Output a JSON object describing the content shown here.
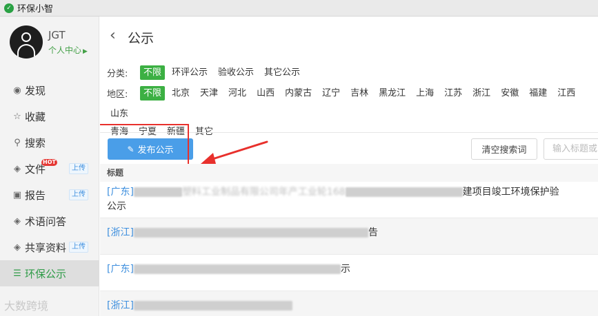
{
  "app": {
    "title": "环保小智"
  },
  "user": {
    "name": "JGT",
    "center_label": "个人中心"
  },
  "nav": {
    "items": [
      {
        "label": "发现",
        "icon": "eye-icon",
        "glyph": "◉"
      },
      {
        "label": "收藏",
        "icon": "star-icon",
        "glyph": "☆"
      },
      {
        "label": "搜索",
        "icon": "search-icon",
        "glyph": "⚲"
      },
      {
        "label": "文件",
        "icon": "layers-icon",
        "glyph": "◈",
        "badge": "HOT",
        "tag": "上传"
      },
      {
        "label": "报告",
        "icon": "report-icon",
        "glyph": "▣",
        "tag": "上传"
      },
      {
        "label": "术语问答",
        "icon": "layers-icon",
        "glyph": "◈"
      },
      {
        "label": "共享资料",
        "icon": "layers-icon",
        "glyph": "◈",
        "tag": "上传"
      },
      {
        "label": "环保公示",
        "icon": "notice-icon",
        "glyph": "☰",
        "active": true
      }
    ]
  },
  "watermark": "大数跨境",
  "page": {
    "back_glyph": "‹",
    "title": "公示"
  },
  "filters": {
    "category_label": "分类:",
    "categories": [
      "不限",
      "环评公示",
      "验收公示",
      "其它公示"
    ],
    "region_label": "地区:",
    "regions": [
      "不限",
      "北京",
      "天津",
      "河北",
      "山西",
      "内蒙古",
      "辽宁",
      "吉林",
      "黑龙江",
      "上海",
      "江苏",
      "浙江",
      "安徽",
      "福建",
      "江西",
      "山东"
    ],
    "regions_row2": [
      "青海",
      "宁夏",
      "新疆",
      "其它"
    ]
  },
  "actions": {
    "publish_label": "发布公示",
    "clear_label": "清空搜索词",
    "search_placeholder": "输入标题或"
  },
  "list": {
    "header": "标题",
    "items": [
      {
        "region": "[广东]",
        "text_a": "塑料工业制品有限公司年产工业轮168",
        "text_b": "建项目竣工环境保护验",
        "text_c": "公示"
      },
      {
        "region": "[浙江]",
        "text_a": "",
        "text_b": "告"
      },
      {
        "region": "[广东]",
        "text_a": "",
        "text_b": "示"
      },
      {
        "region": "[浙江]",
        "text_a": "",
        "text_b": ""
      }
    ]
  }
}
